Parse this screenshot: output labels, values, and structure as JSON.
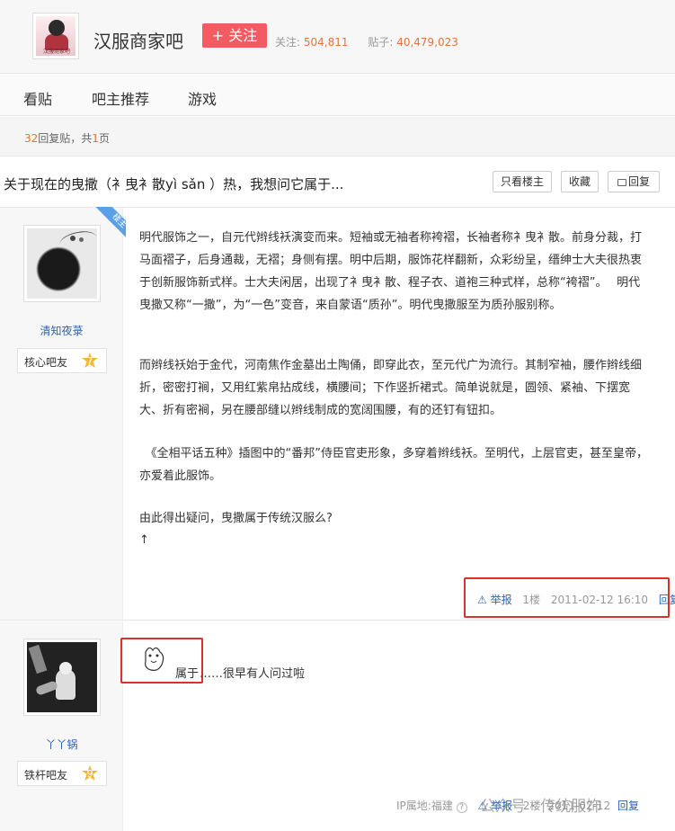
{
  "header": {
    "forum_name": "汉服商家吧",
    "logo_caption": "汉服商家吧",
    "follow_label": "+ 关注",
    "follow_count_label": "关注:",
    "follow_count": "504,811",
    "post_count_label": "贴子:",
    "post_count": "40,479,023"
  },
  "nav": {
    "items": [
      "看贴",
      "吧主推荐",
      "游戏"
    ]
  },
  "thread": {
    "reply_count": "32",
    "reply_count_suffix": "回复贴，共",
    "page_count": "1",
    "page_suffix": "页",
    "title": "关于现在的曳撒（衤曳衤散yì sǎn ）热，我想问它属于...",
    "only_op_label": "只看楼主",
    "favorite_label": "收藏",
    "reply_label": "回复"
  },
  "posts": [
    {
      "badge": "楼主",
      "username": "清知夜菉",
      "level_title": "核心吧友",
      "level": "7",
      "paragraphs": [
        "明代服饰之一，自元代辫线袄演变而来。短袖或无袖者称袴褶，长袖者称衤曳衤散。前身分裁，打马面褶子，后身通裁，无褶；身侧有摆。明中后期，服饰花样翻新，众彩纷呈，缙绅士大夫很热衷于创新服饰新式样。士大夫闲居，出现了衤曳衤散、程子衣、道袍三种式样，总称“袴褶”。　 明代曳撒又称“一撒”，为“一色”变音，来自蒙语“质孙”。明代曳撒服至为质孙服别称。",
        "而辫线袄始于金代，河南焦作金墓出土陶俑，即穿此衣，至元代广为流行。其制窄袖，腰作辫线细折，密密打裥，又用红紫帛拈成线，横腰间；下作竖折裙式。简单说就是，圆领、紧袖、下摆宽大、折有密裥，另在腰部缝以辫线制成的宽阔围腰，有的还钉有钮扣。",
        "　《全相平话五种》插图中的“番邦”侍臣官吏形象，多穿着辫线袄。至明代，上层官吏，甚至皇帝，亦爱着此服饰。",
        " 由此得出疑问，曳撒属于传统汉服么?",
        "↑"
      ],
      "report_label": "举报",
      "floor": "1楼",
      "time": "2011-02-12 16:10",
      "reply_label": "回复"
    },
    {
      "username": "丫丫锅",
      "level_title": "铁杆吧友",
      "level": "9",
      "sticker_text": "属于",
      "text": "……很早有人问过啦",
      "ip_label": "IP属地:福建",
      "report_label": "举报",
      "floor": "2楼",
      "time": "2011-02-12",
      "reply_label": "回复"
    }
  ],
  "watermark": "公众号 · 传统服饰"
}
